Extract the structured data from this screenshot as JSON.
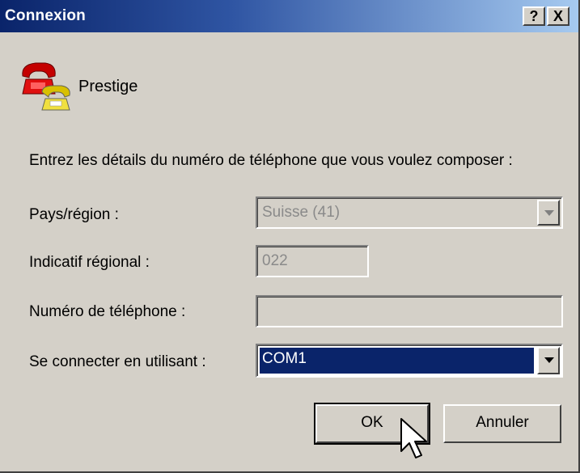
{
  "window": {
    "title": "Connexion",
    "help_label": "?",
    "close_label": "X"
  },
  "header": {
    "icon": "telephone-icon",
    "connection_name": "Prestige"
  },
  "form": {
    "instruction": "Entrez les détails du numéro de téléphone que vous voulez composer :",
    "country": {
      "label": "Pays/région :",
      "value": "Suisse (41)"
    },
    "area_code": {
      "label": "Indicatif régional :",
      "value": "022"
    },
    "phone_number": {
      "label": "Numéro de téléphone :",
      "value": ""
    },
    "connect_using": {
      "label": "Se connecter en utilisant :",
      "value": "COM1"
    }
  },
  "buttons": {
    "ok": "OK",
    "cancel": "Annuler"
  },
  "colors": {
    "selection": "#0a246a",
    "face": "#d4d0c8"
  }
}
